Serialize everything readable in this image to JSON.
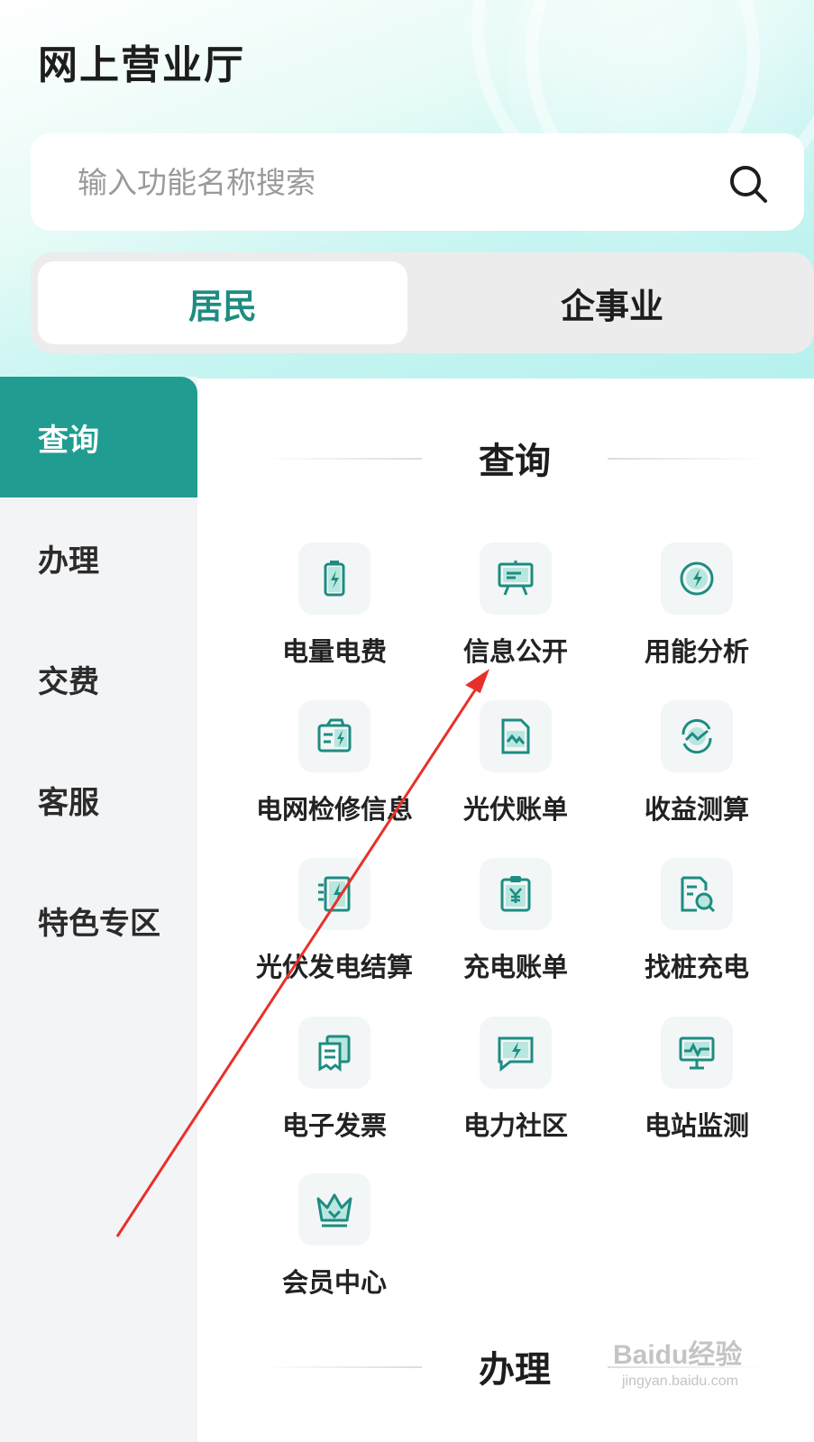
{
  "header": {
    "title": "网上营业厅"
  },
  "search": {
    "placeholder": "输入功能名称搜索"
  },
  "segment": {
    "tabs": [
      {
        "label": "居民"
      },
      {
        "label": "企事业"
      }
    ]
  },
  "sidebar": {
    "items": [
      {
        "label": "查询"
      },
      {
        "label": "办理"
      },
      {
        "label": "交费"
      },
      {
        "label": "客服"
      },
      {
        "label": "特色专区"
      }
    ]
  },
  "main": {
    "section1": {
      "title": "查询",
      "tiles": [
        {
          "label": "电量电费",
          "icon": "battery-bolt-icon"
        },
        {
          "label": "信息公开",
          "icon": "presentation-board-icon"
        },
        {
          "label": "用能分析",
          "icon": "energy-gauge-icon"
        },
        {
          "label": "电网检修信息",
          "icon": "grid-maintenance-icon"
        },
        {
          "label": "光伏账单",
          "icon": "pv-bill-icon"
        },
        {
          "label": "收益测算",
          "icon": "income-calc-icon"
        },
        {
          "label": "光伏发电结算",
          "icon": "pv-settlement-icon"
        },
        {
          "label": "充电账单",
          "icon": "charge-bill-icon"
        },
        {
          "label": "找桩充电",
          "icon": "find-charger-icon"
        },
        {
          "label": "电子发票",
          "icon": "e-invoice-icon"
        },
        {
          "label": "电力社区",
          "icon": "community-chat-icon"
        },
        {
          "label": "电站监测",
          "icon": "station-monitor-icon"
        },
        {
          "label": "会员中心",
          "icon": "crown-icon"
        }
      ]
    },
    "section2": {
      "title": "办理"
    }
  },
  "annotation": {
    "color": "#e8302a"
  },
  "colors": {
    "accent": "#209d90",
    "icon": "#1e8c82"
  },
  "watermark": {
    "text": "Baidu经验",
    "sub": "jingyan.baidu.com"
  }
}
